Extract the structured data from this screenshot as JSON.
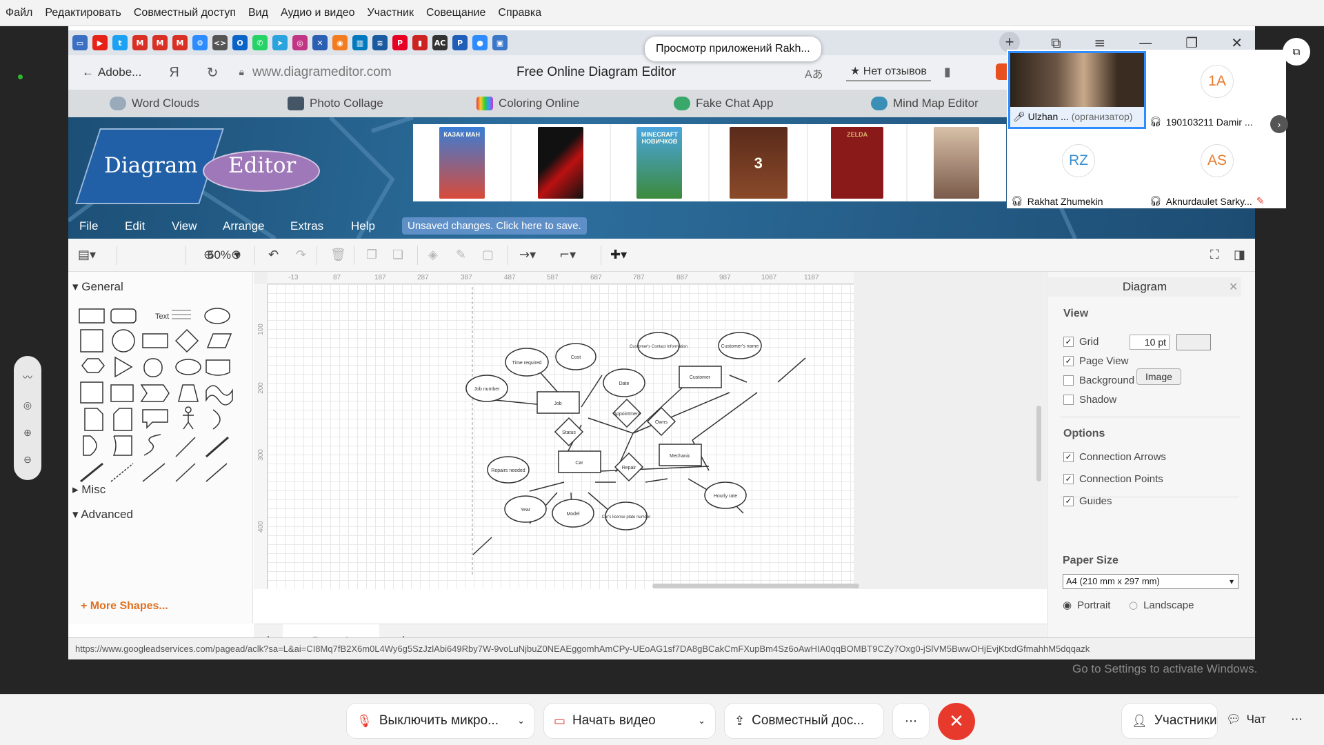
{
  "zoom_menu": [
    "Файл",
    "Редактировать",
    "Совместный доступ",
    "Вид",
    "Аудио и видео",
    "Участник",
    "Совещание",
    "Справка"
  ],
  "tooltip": "Просмотр приложений Rakh...",
  "browser": {
    "back_label": "Adobe...",
    "url": "www.diagrameditor.com",
    "title": "Free Online Diagram Editor",
    "reviews": "★ Нет отзывов",
    "ya": "Я"
  },
  "site_nav": [
    "Word Clouds",
    "Photo Collage",
    "Coloring Online",
    "Fake Chat App",
    "Mind Map Editor"
  ],
  "logo": {
    "part1": "Diagram",
    "part2": "Editor"
  },
  "ad_books": [
    "КАЗАК МАН",
    "",
    "MINECRAFT НОВИЧКОВ",
    "3",
    "ZELDA"
  ],
  "app_menu": [
    "File",
    "Edit",
    "View",
    "Arrange",
    "Extras",
    "Help"
  ],
  "unsaved": "Unsaved changes. Click here to save.",
  "zoom_level": "50%",
  "sidebar": {
    "general": "General",
    "misc": "Misc",
    "advanced": "Advanced",
    "more_shapes": "More Shapes...",
    "text_shape": "Text"
  },
  "ruler_top": [
    "-13",
    "87",
    "187",
    "287",
    "387",
    "487",
    "587",
    "687",
    "787",
    "887",
    "987",
    "1087",
    "1187"
  ],
  "ruler_left": [
    "100",
    "200",
    "300",
    "400"
  ],
  "er_entities": [
    "Job",
    "Customer",
    "Car",
    "Mechanic"
  ],
  "er_relations": [
    "Appointment",
    "Owns",
    "Status",
    "Repair"
  ],
  "er_attributes": [
    "Time required",
    "Cost",
    "Job number",
    "Customer's Contact information",
    "Customer's name",
    "Date",
    "Repairs needed",
    "Year",
    "Model",
    "Car's license plate number",
    "Hourly rate"
  ],
  "page_tab": "Page-1",
  "format_panel": {
    "title": "Diagram",
    "view": "View",
    "grid": "Grid",
    "grid_size": "10 pt",
    "page_view": "Page View",
    "background": "Background",
    "image_btn": "Image",
    "shadow": "Shadow",
    "options": "Options",
    "connection_arrows": "Connection Arrows",
    "connection_points": "Connection Points",
    "guides": "Guides",
    "paper_size_label": "Paper Size",
    "paper_size": "A4 (210 mm x 297 mm)",
    "portrait": "Portrait",
    "landscape": "Landscape"
  },
  "status_url": "https://www.googleadservices.com/pagead/aclk?sa=L&ai=CI8Mq7fB2X6m0L4Wy6g5SzJzlAbi649Rby7W-9voLuNjbuZ0NEAEggomhAmCPy-UEoAG1sf7DA8gBCakCmFXupBm4Sz6oAwHIA0qqBOMBT9CZy7Oxg0-jSlVM5BwwOHjEvjKtxdGfmahhM5dqqazk",
  "activate_windows": "Go to Settings to activate Windows.",
  "participants": {
    "host_name": "Ulzhan ...",
    "host_role": "(организатор)",
    "p1_initials": "1A",
    "p1_name": "190103211 Damir ...",
    "p2_initials": "RZ",
    "p2_name": "Rakhat Zhumekin",
    "p3_initials": "AS",
    "p3_name": "Aknurdaulet Sarky..."
  },
  "controls": {
    "mute": "Выключить микро...",
    "video": "Начать видео",
    "share": "Совместный дос...",
    "participants": "Участники",
    "chat": "Чат"
  },
  "colors": {
    "accent": "#2d8cff",
    "end_call": "#e8392d",
    "banner": "#2d6f9e",
    "unsaved": "#5f8fc7"
  }
}
